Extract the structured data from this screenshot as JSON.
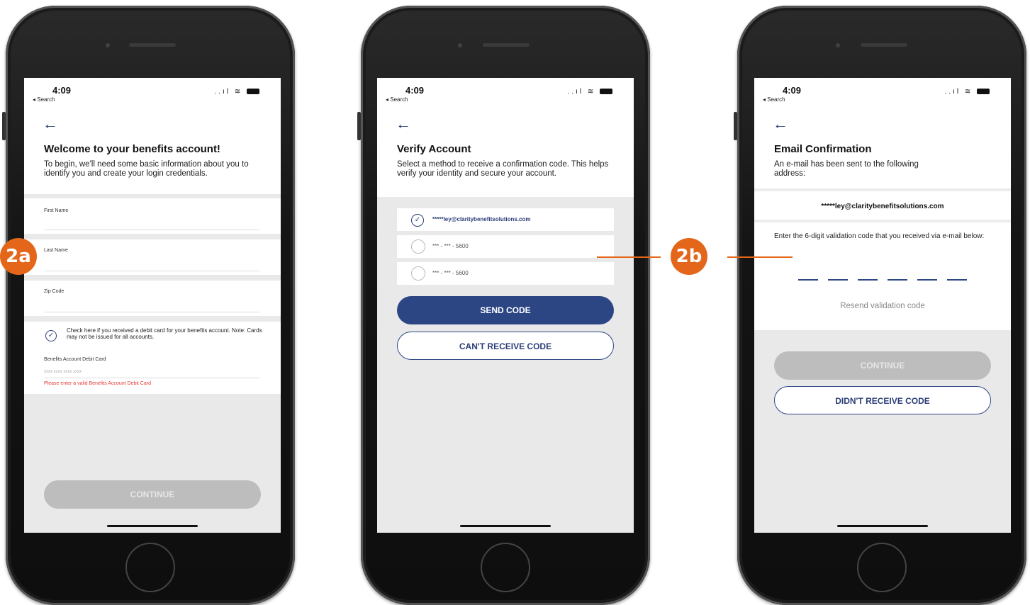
{
  "status": {
    "time": "4:09",
    "back_app": "◂ Search",
    "signal": "..ıl",
    "wifi": "≋"
  },
  "badges": {
    "a": "2a",
    "b": "2b"
  },
  "screen1": {
    "title": "Welcome to your benefits account!",
    "description": "To begin, we'll need some basic information about you to identify you and create your login credentials.",
    "fields": [
      "First Name",
      "Last Name",
      "Zip Code"
    ],
    "checkbox_text": "Check here if you received a debit card for your benefits account. Note: Cards may not be issued for all accounts.",
    "card_label": "Benefits Account Debit Card",
    "card_placeholder": "xxxx xxxx xxxx xxxx",
    "error": "Please enter a valid Benefits Account Debit Card",
    "continue_label": "CONTINUE"
  },
  "screen2": {
    "title": "Verify Account",
    "description": "Select a method to receive a confirmation code. This helps verify your identity and secure your account.",
    "options": [
      "*****ley@claritybenefitsolutions.com",
      "*** - *** - 5600",
      "*** - *** - 5600"
    ],
    "send_label": "SEND CODE",
    "cant_label": "CAN'T RECEIVE CODE"
  },
  "screen3": {
    "title": "Email Confirmation",
    "description": "An e-mail has been sent to the following address:",
    "email": "*****ley@claritybenefitsolutions.com",
    "instruction": "Enter the 6-digit validation code that you received via e-mail below:",
    "resend_label": "Resend validation code",
    "continue_label": "CONTINUE",
    "didnt_label": "DIDN'T RECEIVE CODE"
  },
  "colors": {
    "accent": "#e4661a",
    "primary": "#2c4684",
    "error": "#e53935"
  }
}
